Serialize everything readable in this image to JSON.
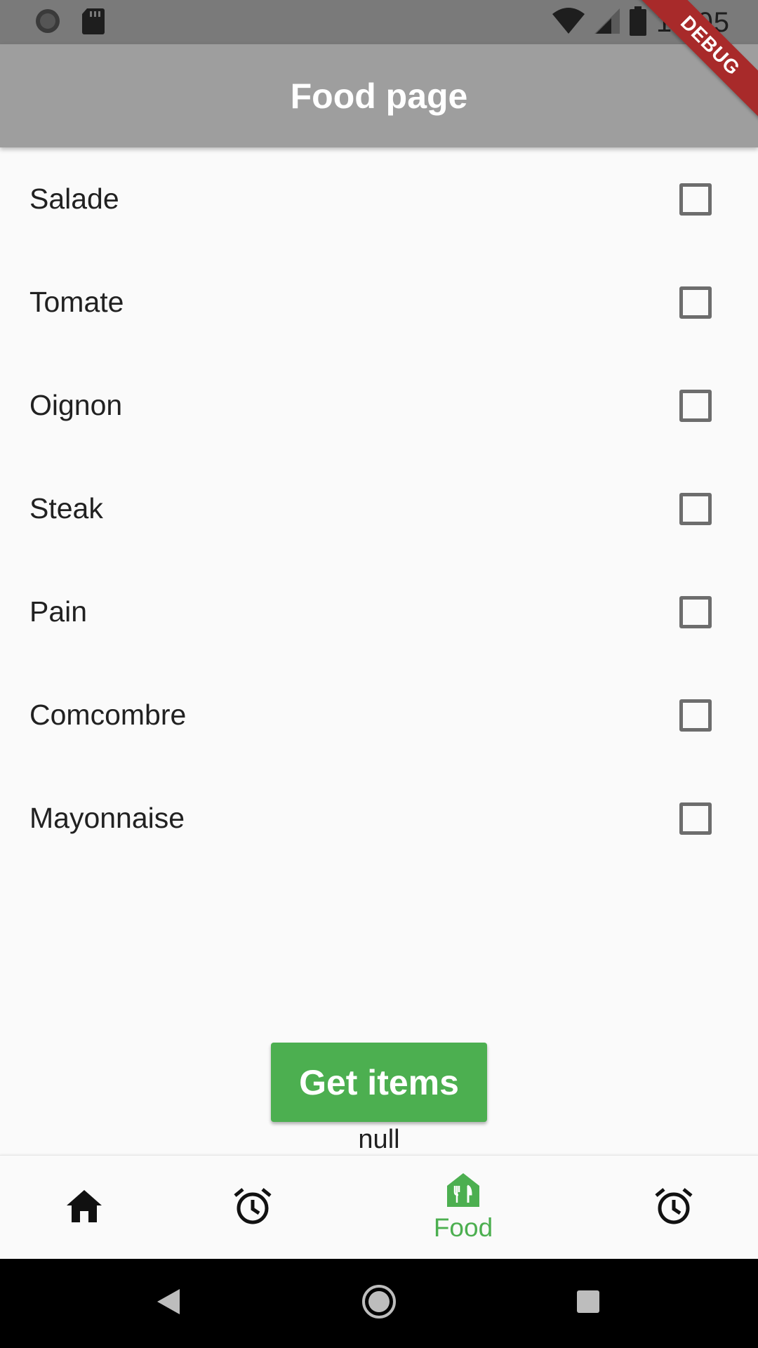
{
  "status_bar": {
    "time": "12:05",
    "icons": [
      "sync-icon",
      "sd-card-icon",
      "wifi-icon",
      "signal-icon",
      "battery-icon"
    ]
  },
  "debug_banner": "DEBUG",
  "app_bar": {
    "title": "Food page"
  },
  "food_items": [
    {
      "label": "Salade",
      "checked": false
    },
    {
      "label": "Tomate",
      "checked": false
    },
    {
      "label": "Oignon",
      "checked": false
    },
    {
      "label": "Steak",
      "checked": false
    },
    {
      "label": "Pain",
      "checked": false
    },
    {
      "label": "Comcombre",
      "checked": false
    },
    {
      "label": "Mayonnaise",
      "checked": false
    }
  ],
  "get_items_button": {
    "label": "Get items"
  },
  "result_text": "null",
  "bottom_nav": {
    "items": [
      {
        "icon": "home-icon",
        "label": ""
      },
      {
        "icon": "alarm-icon",
        "label": ""
      },
      {
        "icon": "restaurant-icon",
        "label": "Food",
        "active": true
      },
      {
        "icon": "alarm-icon",
        "label": ""
      }
    ],
    "active_color": "#4caf50"
  },
  "system_nav": [
    "back-icon",
    "home-circle-icon",
    "recents-icon"
  ],
  "colors": {
    "app_bar": "#9e9e9e",
    "accent": "#4caf50",
    "status_bar": "#7a7a7a"
  }
}
